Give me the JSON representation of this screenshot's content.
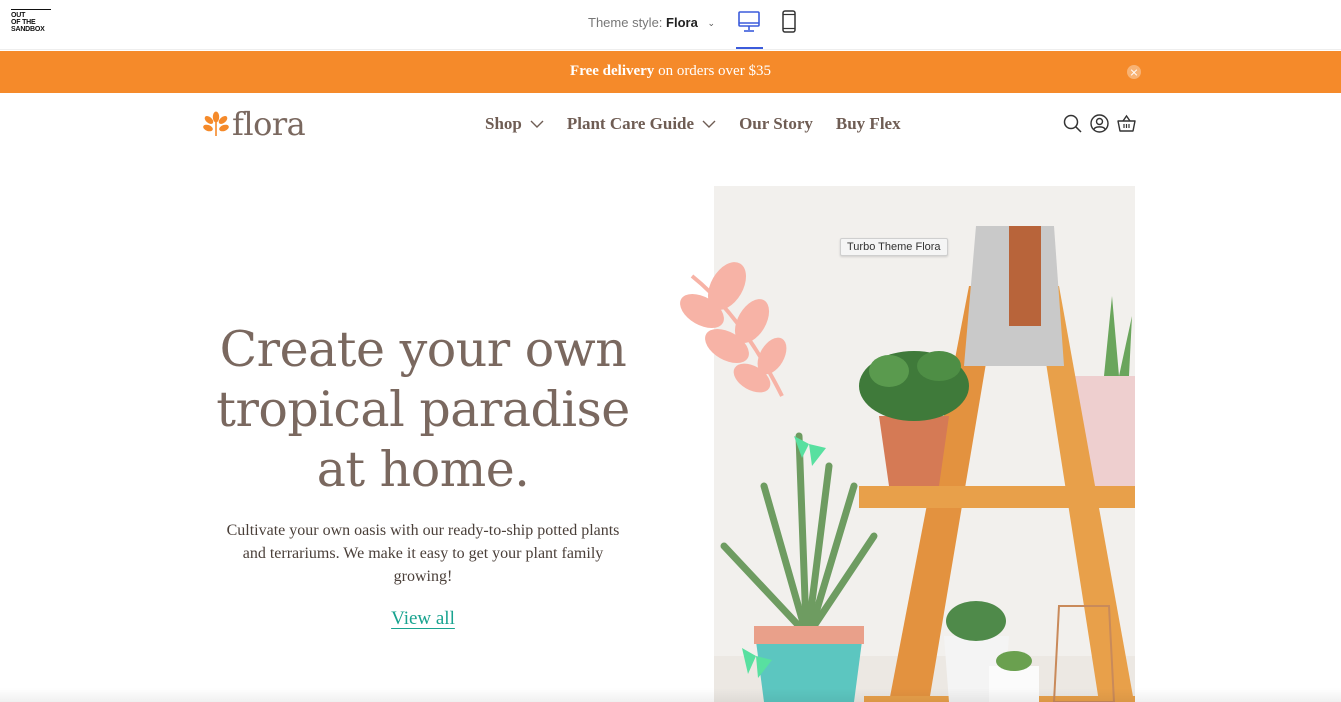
{
  "preview_bar": {
    "vendor_logo_text": [
      "OUT",
      "OF THE",
      "SANDBOX"
    ],
    "theme_style_label": "Theme style:",
    "theme_style_value": "Flora",
    "devices": [
      {
        "name": "desktop",
        "selected": true
      },
      {
        "name": "mobile",
        "selected": false
      }
    ],
    "accent_color": "#3b5bdb"
  },
  "announcement": {
    "bold_text": "Free delivery",
    "text": " on orders over $35",
    "background_color": "#f58a2a",
    "close_icon": "close-icon"
  },
  "header": {
    "logo_text": "flora",
    "logo_icon": "leaf-icon",
    "logo_color": "#f58a2a",
    "nav": [
      {
        "label": "Shop",
        "has_dropdown": true
      },
      {
        "label": "Plant Care Guide",
        "has_dropdown": true
      },
      {
        "label": "Our Story",
        "has_dropdown": false
      },
      {
        "label": "Buy Flex",
        "has_dropdown": false
      }
    ],
    "icons": [
      "search-icon",
      "account-icon",
      "cart-icon"
    ]
  },
  "hero": {
    "headline": "Create your own tropical paradise at home.",
    "subtext": "Cultivate your own oasis with our ready-to-ship potted plants and terrariums. We make it easy to get your plant family growing!",
    "cta_label": "View all",
    "cta_color": "#18a38f",
    "image_tooltip": "Turbo Theme Flora"
  }
}
